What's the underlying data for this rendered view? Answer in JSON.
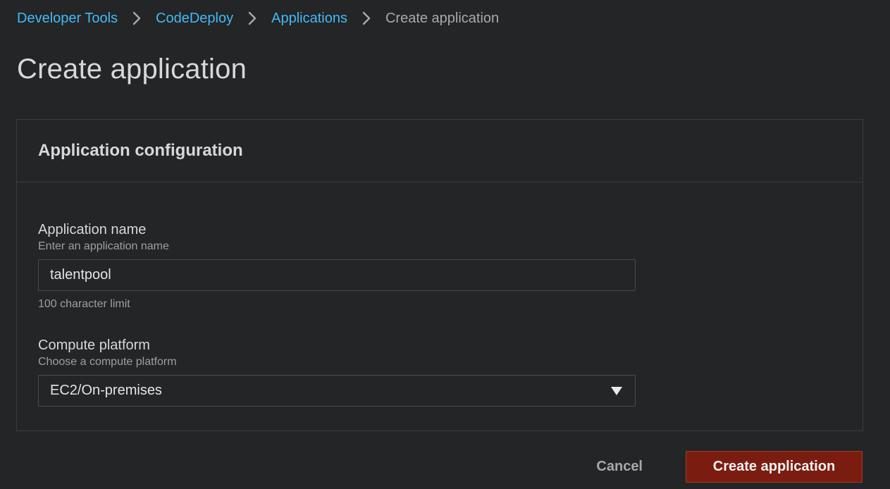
{
  "breadcrumb": {
    "items": [
      {
        "label": "Developer Tools"
      },
      {
        "label": "CodeDeploy"
      },
      {
        "label": "Applications"
      }
    ],
    "current": "Create application"
  },
  "page": {
    "title": "Create application"
  },
  "panel": {
    "title": "Application configuration",
    "app_name": {
      "label": "Application name",
      "description": "Enter an application name",
      "value": "talentpool",
      "hint": "100 character limit"
    },
    "compute_platform": {
      "label": "Compute platform",
      "description": "Choose a compute platform",
      "selected": "EC2/On-premises"
    }
  },
  "actions": {
    "cancel_label": "Cancel",
    "submit_label": "Create application"
  },
  "icons": {
    "breadcrumb_separator": "chevron-right-icon",
    "select_caret": "caret-down-icon"
  },
  "colors": {
    "background": "#232526",
    "link": "#44b9f3",
    "primary_button": "#7a1d10"
  }
}
